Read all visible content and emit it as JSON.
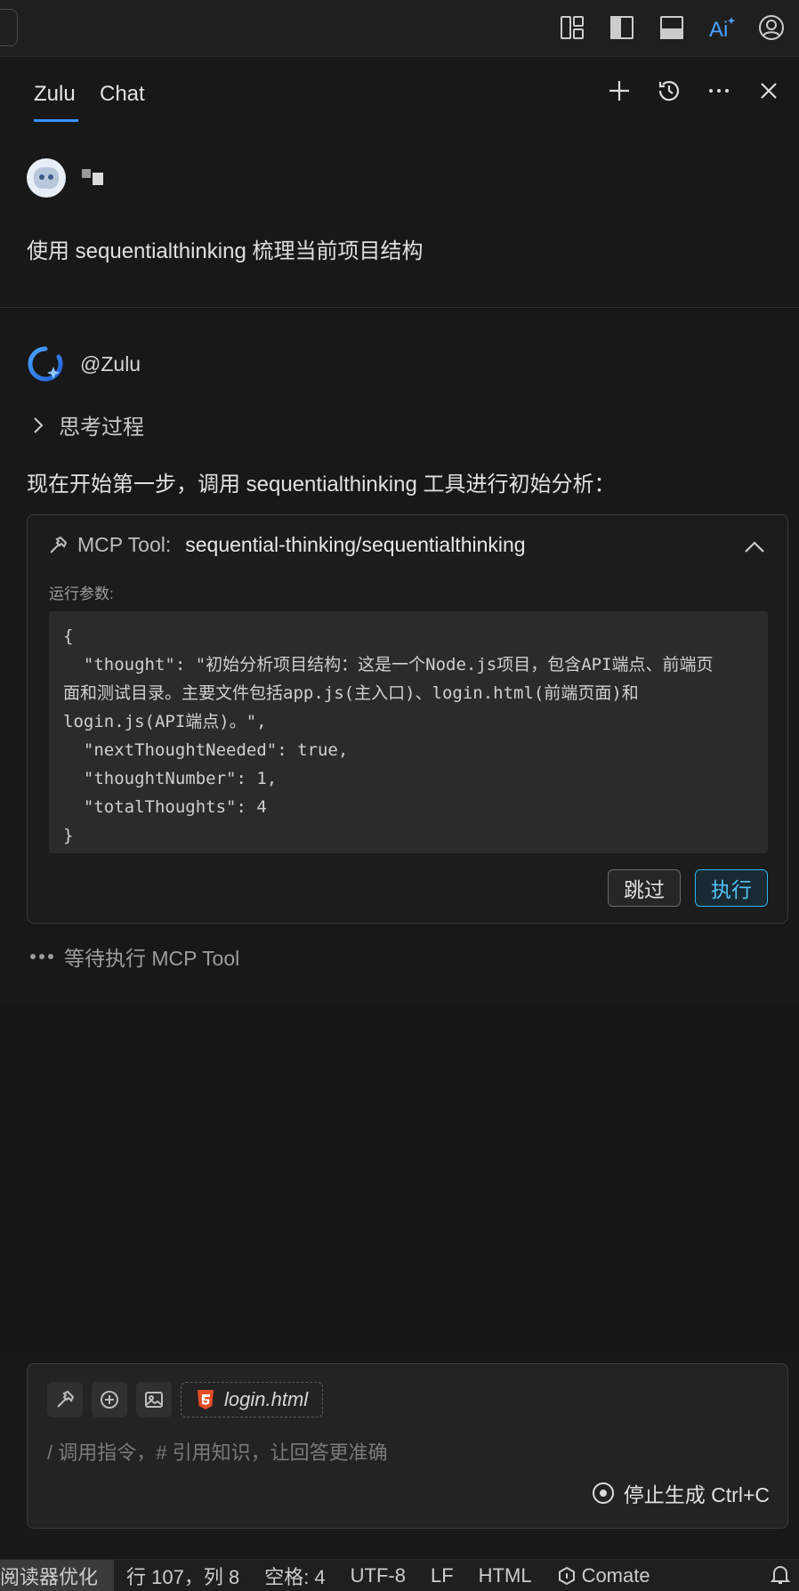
{
  "panel": {
    "tabs": [
      {
        "label": "Zulu",
        "active": true
      },
      {
        "label": "Chat",
        "active": false
      }
    ]
  },
  "icons": {
    "titlebar": [
      "layout-icon",
      "sidebar-toggle-icon",
      "panel-toggle-icon",
      "ai-icon",
      "account-icon"
    ],
    "panel_actions": [
      "plus-icon",
      "history-icon",
      "more-icon",
      "close-icon"
    ]
  },
  "user": {
    "message": "使用 sequentialthinking 梳理当前项目结构"
  },
  "bot": {
    "name": "@Zulu",
    "thinking_label": "思考过程",
    "message": "现在开始第一步，调用 sequentialthinking 工具进行初始分析："
  },
  "mcp": {
    "label": "MCP Tool:",
    "tool_name": "sequential-thinking/sequentialthinking",
    "params_label": "运行参数:",
    "code": "{\n  \"thought\": \"初始分析项目结构：这是一个Node.js项目，包含API端点、前端页\n面和测试目录。主要文件包括app.js(主入口)、login.html(前端页面)和\nlogin.js(API端点)。\",\n  \"nextThoughtNeeded\": true,\n  \"thoughtNumber\": 1,\n  \"totalThoughts\": 4\n}",
    "skip_label": "跳过",
    "run_label": "执行"
  },
  "waiting": "等待执行 MCP Tool",
  "input": {
    "file_chip": "login.html",
    "placeholder": "/ 调用指令，# 引用知识，让回答更准确",
    "stop_label": "停止生成 Ctrl+C"
  },
  "statusbar": {
    "reader": "阅读器优化",
    "position": "行 107，列 8",
    "spaces": "空格: 4",
    "encoding": "UTF-8",
    "eol": "LF",
    "language": "HTML",
    "comate": "Comate"
  },
  "colors": {
    "accent": "#3794ff",
    "run_button": "#29b6f6",
    "background": "#181818"
  }
}
